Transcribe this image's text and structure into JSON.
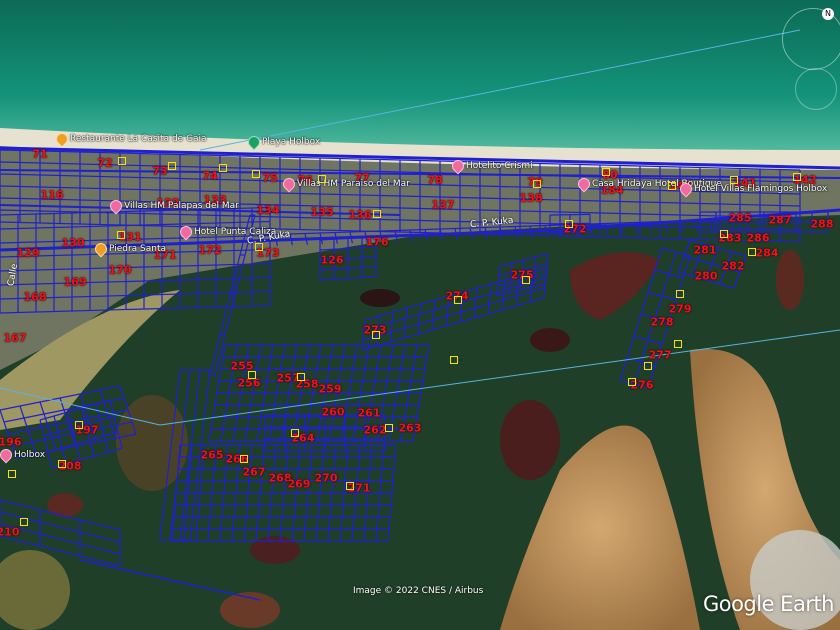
{
  "map": {
    "credit": "Image © 2022 CNES / Airbus",
    "logo": "Google Earth",
    "north_label": "N",
    "colors": {
      "parcel_line": "#2020d0",
      "lot_label": "#e8141e",
      "marker": "#f4e400",
      "path_line": "#5ab4e0"
    },
    "roads": [
      "C. P. Kuka",
      "C. P. Kuka",
      "Calle"
    ],
    "places": [
      {
        "name": "Restaurante La Casita de Gaia",
        "icon": "restaurant-pin-icon",
        "color": "#f0a020"
      },
      {
        "name": "Playa Holbox",
        "icon": "beach-pin-icon",
        "color": "#1aa060"
      },
      {
        "name": "Villas HM Paraiso del Mar",
        "icon": "hotel-pin-icon",
        "color": "#f06aa0"
      },
      {
        "name": "Villas HM Palapas del Mar",
        "icon": "hotel-pin-icon",
        "color": "#f06aa0"
      },
      {
        "name": "Hotel Punta Caliza",
        "icon": "hotel-pin-icon",
        "color": "#f06aa0"
      },
      {
        "name": "Piedra Santa",
        "icon": "restaurant-pin-icon",
        "color": "#f0a020"
      },
      {
        "name": "Hotelito Crismi",
        "icon": "hotel-pin-icon",
        "color": "#f06aa0"
      },
      {
        "name": "Casa Hridaya Hotel Boutique",
        "icon": "hotel-pin-icon",
        "color": "#f06aa0"
      },
      {
        "name": "Hotel Villas Flamingos Holbox",
        "icon": "hotel-pin-icon",
        "color": "#f06aa0"
      },
      {
        "name": "Holbox",
        "icon": "hotel-pin-icon",
        "color": "#f06aa0"
      }
    ],
    "lots": [
      "71",
      "72",
      "73",
      "74",
      "75",
      "76",
      "77",
      "78",
      "79",
      "80",
      "184",
      "140",
      "141",
      "142",
      "116",
      "132",
      "133",
      "134",
      "135",
      "136",
      "137",
      "138",
      "131",
      "130",
      "129",
      "171",
      "172",
      "173",
      "176",
      "126",
      "170",
      "169",
      "168",
      "167",
      "272",
      "285",
      "287",
      "288",
      "283",
      "286",
      "284",
      "281",
      "282",
      "280",
      "279",
      "278",
      "277",
      "276",
      "275",
      "274",
      "273",
      "255",
      "256",
      "257",
      "258",
      "259",
      "260",
      "261",
      "262",
      "263",
      "264",
      "265",
      "266",
      "267",
      "268",
      "269",
      "270",
      "271",
      "196",
      "197",
      "208",
      "210"
    ]
  }
}
